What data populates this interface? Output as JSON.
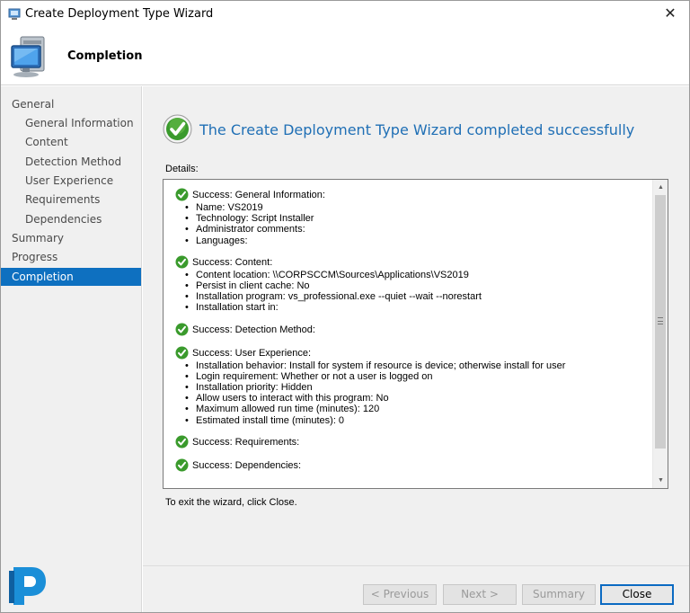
{
  "window": {
    "title": "Create Deployment Type Wizard",
    "close_glyph": "✕"
  },
  "header": {
    "title": "Completion",
    "icon": "computer-icon"
  },
  "nav": {
    "items": [
      {
        "label": "General",
        "level": 0,
        "selected": false
      },
      {
        "label": "General Information",
        "level": 1,
        "selected": false
      },
      {
        "label": "Content",
        "level": 1,
        "selected": false
      },
      {
        "label": "Detection Method",
        "level": 1,
        "selected": false
      },
      {
        "label": "User Experience",
        "level": 1,
        "selected": false
      },
      {
        "label": "Requirements",
        "level": 1,
        "selected": false
      },
      {
        "label": "Dependencies",
        "level": 1,
        "selected": false
      },
      {
        "label": "Summary",
        "level": 0,
        "selected": false
      },
      {
        "label": "Progress",
        "level": 0,
        "selected": false
      },
      {
        "label": "Completion",
        "level": 0,
        "selected": true
      }
    ]
  },
  "main": {
    "heading": "The Create Deployment Type Wizard completed successfully",
    "details_label": "Details:",
    "exit_text": "To exit the wizard, click Close.",
    "sections": [
      {
        "title": "Success: General Information:",
        "items": [
          "Name: VS2019",
          "Technology: Script Installer",
          "Administrator comments:",
          "Languages:"
        ]
      },
      {
        "title": "Success: Content:",
        "items": [
          "Content location: \\\\CORPSCCM\\Sources\\Applications\\VS2019",
          "Persist in client cache: No",
          "Installation program: vs_professional.exe --quiet --wait --norestart",
          "Installation start in:"
        ]
      },
      {
        "title": "Success: Detection Method:",
        "items": []
      },
      {
        "title": "Success: User Experience:",
        "items": [
          "Installation behavior: Install for system if resource is device; otherwise install for user",
          "Login requirement: Whether or not a user is logged on",
          "Installation priority: Hidden",
          "Allow users to interact with this program: No",
          "Maximum allowed run time (minutes): 120",
          "Estimated install time (minutes): 0"
        ]
      },
      {
        "title": "Success: Requirements:",
        "items": []
      },
      {
        "title": "Success: Dependencies:",
        "items": []
      }
    ]
  },
  "footer": {
    "previous": "< Previous",
    "next": "Next >",
    "summary": "Summary",
    "close": "Close"
  },
  "colors": {
    "accent": "#0e70c0",
    "heading": "#1f6fb5",
    "success": "#3a9a2c"
  }
}
